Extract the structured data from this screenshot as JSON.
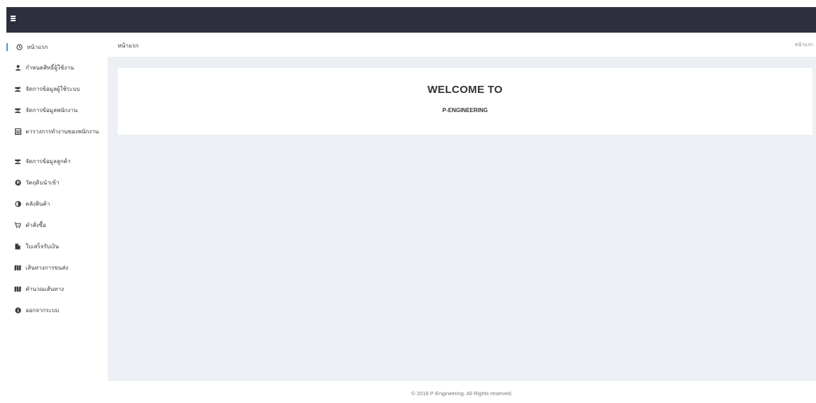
{
  "header": {
    "menu_icon": "hamburger-icon"
  },
  "sidebar": {
    "items": [
      {
        "label": "หน้าแรก",
        "icon": "clock-icon",
        "active": true
      },
      {
        "label": "กำหนดสิทธิ์ผู้ใช้งาน",
        "icon": "user-icon"
      },
      {
        "label": "จัดการข้อมูลผู้ใช้ระบบ",
        "icon": "users-icon"
      },
      {
        "label": "จัดการข้อมูลพนักงาน",
        "icon": "users-icon"
      },
      {
        "label": "ตารางการทำงานของพนักงาน",
        "icon": "table-icon"
      },
      {
        "label": "จัดการข้อมูลลูกค้า",
        "icon": "users-icon"
      },
      {
        "label": "วัตถุดิบนำเข้า",
        "icon": "product-hunt-icon"
      },
      {
        "label": "คลังสินค้า",
        "icon": "adjust-icon"
      },
      {
        "label": "คำสั่งซื้อ",
        "icon": "cart-icon"
      },
      {
        "label": "ใบเสร็จรับเงิน",
        "icon": "file-icon"
      },
      {
        "label": "เส้นทางการขนส่ง",
        "icon": "map-icon"
      },
      {
        "label": "คำนวณเส้นทาง",
        "icon": "map-icon"
      },
      {
        "label": "ออกจากระบบ",
        "icon": "info-icon"
      }
    ]
  },
  "breadcrumb": {
    "left": "หน้าแรก",
    "right": "หน้าแรก"
  },
  "welcome": {
    "title": "WELCOME TO",
    "subtitle": "P-ENGINEERING"
  },
  "footer": {
    "text": "© 2018 P-Engineering. All Rights reserved."
  },
  "colors": {
    "topbar": "#2d2f3d",
    "accent": "#3b9cd9",
    "content_bg": "#eceff3"
  }
}
